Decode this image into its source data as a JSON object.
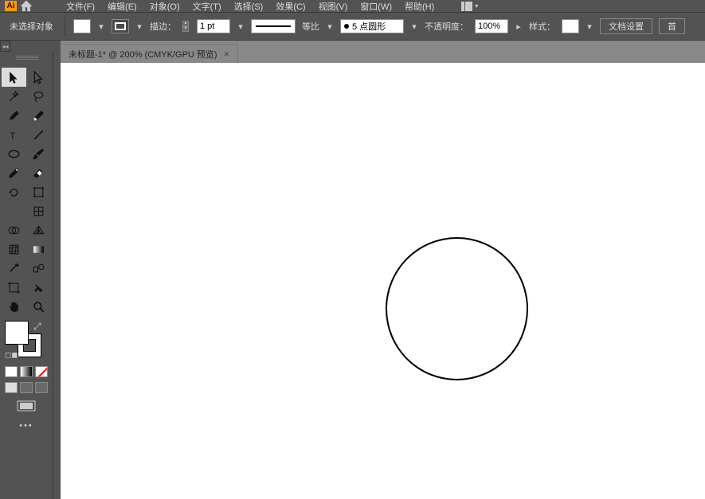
{
  "menubar": {
    "app_icon": "Ai",
    "items": [
      "文件(F)",
      "编辑(E)",
      "对象(O)",
      "文字(T)",
      "选择(S)",
      "效果(C)",
      "视图(V)",
      "窗口(W)",
      "帮助(H)"
    ]
  },
  "optbar": {
    "selection_status": "未选择对象",
    "stroke_label": "描边：",
    "stroke_weight": "1 pt",
    "profile_label": "等比",
    "brush_label": "5 点圆形",
    "opacity_label": "不透明度：",
    "opacity_value": "100%",
    "style_label": "样式：",
    "doc_setup": "文档设置",
    "prefs": "首"
  },
  "tab": {
    "title": "未标题-1* @ 200% (CMYK/GPU 预览)"
  },
  "tools": {
    "left": [
      "selection",
      "magic-wand",
      "pen",
      "type",
      "ellipse",
      "pencil",
      "rotate",
      "width",
      "shape-builder",
      "mesh",
      "eyedropper",
      "artboard",
      "hand"
    ],
    "right": [
      "direct-selection",
      "lasso",
      "curvature",
      "line",
      "paintbrush",
      "eraser",
      "free-transform",
      "puppet-warp",
      "perspective",
      "gradient",
      "blend",
      "slice",
      "zoom"
    ]
  }
}
